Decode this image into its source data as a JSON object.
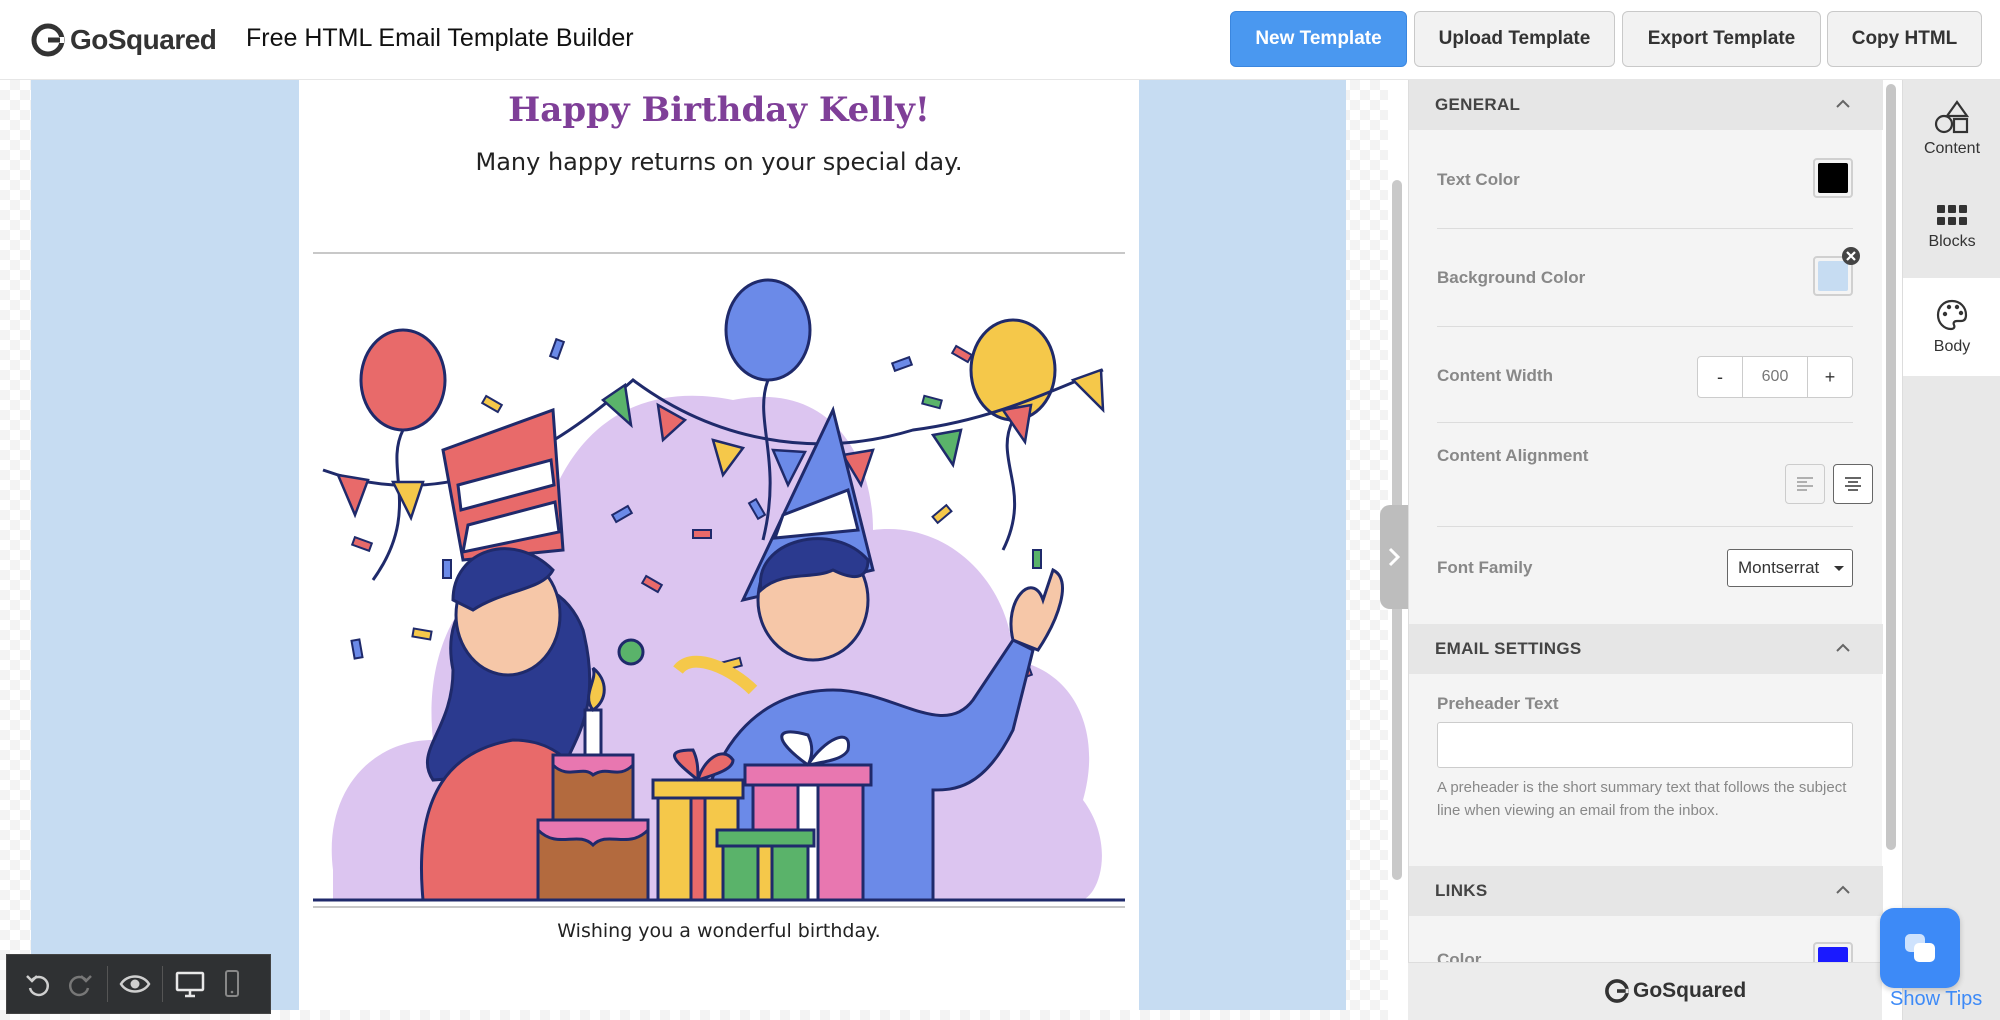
{
  "header": {
    "brand": "GoSquared",
    "app_title": "Free HTML Email Template Builder",
    "buttons": {
      "new_template": "New Template",
      "upload_template": "Upload Template",
      "export_template": "Export Template",
      "copy_html": "Copy HTML"
    }
  },
  "email": {
    "heading": "Happy Birthday Kelly!",
    "subheading": "Many happy returns on your special day.",
    "footer_text": "Wishing you a wonderful birthday.",
    "colors": {
      "background": "#c6dcf2",
      "heading": "#7f3f98"
    }
  },
  "panel": {
    "general": {
      "title": "GENERAL",
      "text_color_label": "Text Color",
      "text_color": "#000000",
      "background_color_label": "Background Color",
      "background_color": "#c6dcf2",
      "content_width_label": "Content Width",
      "content_width_decrement": "-",
      "content_width_value": "600",
      "content_width_increment": "+",
      "content_alignment_label": "Content Alignment",
      "font_family_label": "Font Family",
      "font_family_value": "Montserrat"
    },
    "email_settings": {
      "title": "EMAIL SETTINGS",
      "preheader_label": "Preheader Text",
      "preheader_value": "",
      "preheader_help": "A preheader is the short summary text that follows the subject line when viewing an email from the inbox."
    },
    "links": {
      "title": "LINKS",
      "color_label": "Color",
      "color": "#1a1aff"
    },
    "footer_brand": "GoSquared"
  },
  "sidetabs": {
    "content": "Content",
    "blocks": "Blocks",
    "body": "Body"
  },
  "show_tips": "Show Tips",
  "icons": [
    "undo-icon",
    "redo-icon",
    "preview-eye-icon",
    "desktop-icon",
    "mobile-icon",
    "shapes-icon",
    "grid-icon",
    "palette-icon",
    "chevron-up-icon",
    "chevron-right-icon",
    "chat-icon"
  ]
}
